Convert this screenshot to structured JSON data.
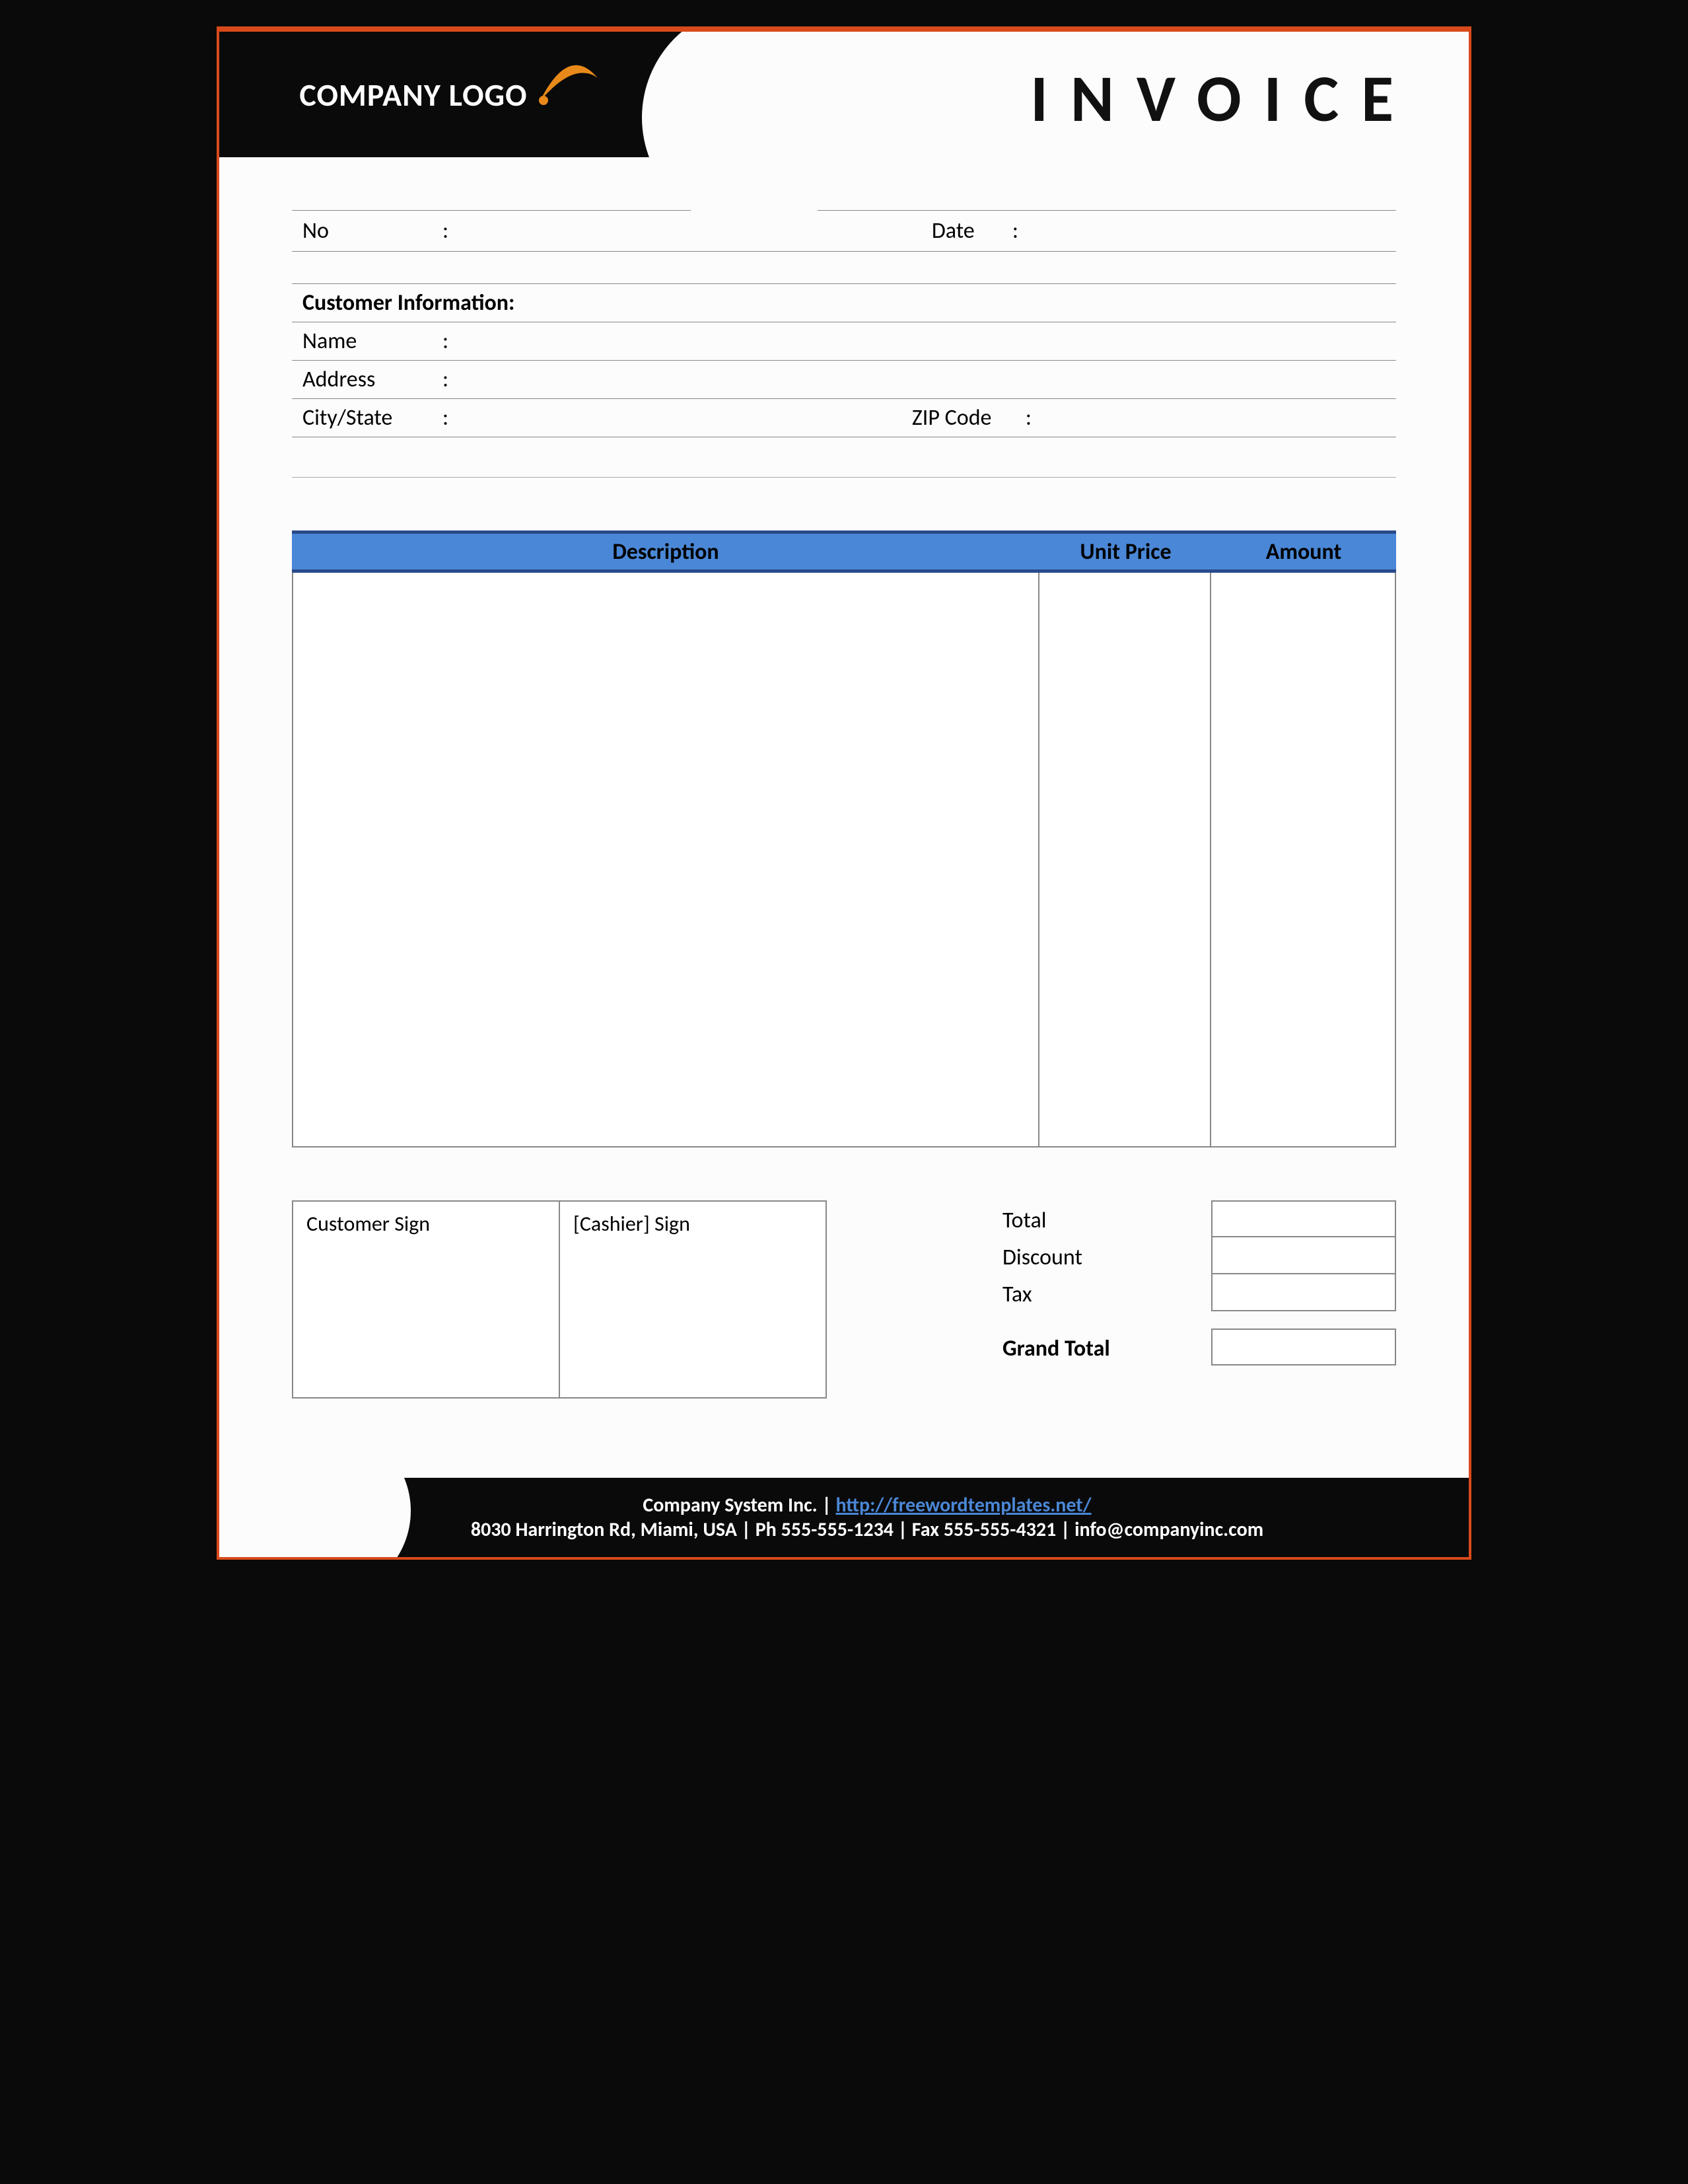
{
  "header": {
    "company_logo_text": "COMPANY LOGO",
    "invoice_title": "INVOICE"
  },
  "meta": {
    "no_label": "No",
    "no_value": "",
    "date_label": "Date",
    "date_value": ""
  },
  "customer": {
    "section_title": "Customer Information:",
    "name_label": "Name",
    "name_value": "",
    "address_label": "Address",
    "address_value": "",
    "city_label": "City/State",
    "city_value": "",
    "zip_label": "ZIP Code",
    "zip_value": ""
  },
  "items": {
    "headers": {
      "description": "Description",
      "unit_price": "Unit Price",
      "amount": "Amount"
    }
  },
  "signatures": {
    "customer": "Customer Sign",
    "cashier": "[Cashier] Sign"
  },
  "totals": {
    "total_label": "Total",
    "total_value": "",
    "discount_label": "Discount",
    "discount_value": "",
    "tax_label": "Tax",
    "tax_value": "",
    "grand_label": "Grand Total",
    "grand_value": ""
  },
  "footer": {
    "company": "Company System Inc.",
    "separator": " | ",
    "url": "http://freewordtemplates.net/",
    "line2": "8030 Harrington Rd, Miami, USA | Ph 555-555-1234 | Fax 555-555-4321 | info@companyinc.com"
  }
}
